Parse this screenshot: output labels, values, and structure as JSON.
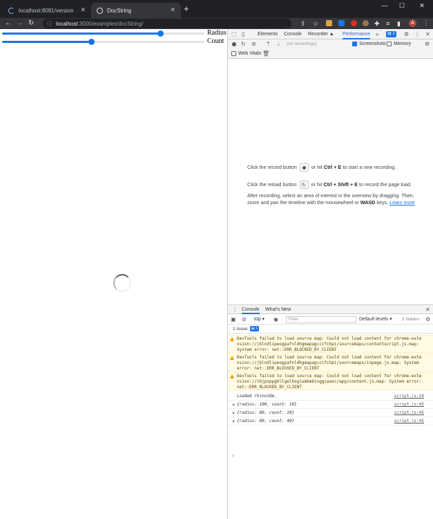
{
  "browser": {
    "tabs": [
      {
        "label": "localhost:8081/version",
        "active": false
      },
      {
        "label": "DocString",
        "active": true
      }
    ],
    "new_tab": "+",
    "window_controls": {
      "minimize": "—",
      "maximize": "☐",
      "close": "✕"
    },
    "url_host": "localhost",
    "url_rest": ":3000/examples/docString/",
    "avatar_letter": "A"
  },
  "page": {
    "sliders": [
      {
        "label": "Radius",
        "value_fraction": 0.78
      },
      {
        "label": "Count",
        "value_fraction": 0.44
      }
    ]
  },
  "devtools": {
    "tabs": [
      "Elements",
      "Console",
      "Recorder ▲",
      "Performance"
    ],
    "more": "»",
    "issues_count": "1",
    "recordings_placeholder": "(no recordings)",
    "screenshots_label": "Screenshots",
    "memory_label": "Memory",
    "web_vitals_label": "Web Vitals",
    "hint_record_pre": "Click the record button",
    "hint_record_post": "or hit",
    "hint_record_keys": "Ctrl + E",
    "hint_record_end": "to start a new recording.",
    "hint_reload_pre": "Click the reload button",
    "hint_reload_post": "or hit",
    "hint_reload_keys": "Ctrl + Shift + E",
    "hint_reload_end": "to record the page load.",
    "hint_after_1": "After recording, select an area of interest in the overview by dragging. Then,",
    "hint_after_2_pre": "zoom and pan the timeline with the mousewheel or",
    "hint_after_2_keys": "WASD",
    "hint_after_2_mid": "keys.",
    "learn_more": "Learn more"
  },
  "console": {
    "tabs": [
      "Console",
      "What's New"
    ],
    "context": "top ▾",
    "filter_placeholder": "Filter",
    "levels": "Default levels ▾",
    "hidden": "3 hidden",
    "issue_label": "1 Issue:",
    "issue_count": "1",
    "messages": [
      {
        "type": "warn",
        "text": "DevTools failed to load source map: Could not load content for chrome-extension://jblndlipeogpafnldhgmapagcccfchpi/sourcemaps/contentscript.js.map: System error: net::ERR_BLOCKED_BY_CLIENT"
      },
      {
        "type": "warn",
        "text": "DevTools failed to load source map: Could not load content for chrome-extension://jblndlipeogpafnldhgmapagcccfchpi/sourcemaps/inpage.js.map: System error: net::ERR_BLOCKED_BY_CLIENT"
      },
      {
        "type": "warn",
        "text": "DevTools failed to load source map: Could not load content for chrome-extension://ibjpoppgbllgelhogiomkmbinggcaaoc/app/content.js.map: System error: net::ERR_BLOCKED_BY_CLIENT"
      },
      {
        "type": "log",
        "text": "Loaded rhino3dm.",
        "src": "script.js:24"
      },
      {
        "type": "obj",
        "text": "{radius: 100, count: 10}",
        "src": "script.js:45"
      },
      {
        "type": "obj",
        "text": "{radius: 80, count: 10}",
        "src": "script.js:45"
      },
      {
        "type": "obj",
        "text": "{radius: 80, count: 49}",
        "src": "script.js:45"
      }
    ],
    "prompt": "›"
  }
}
